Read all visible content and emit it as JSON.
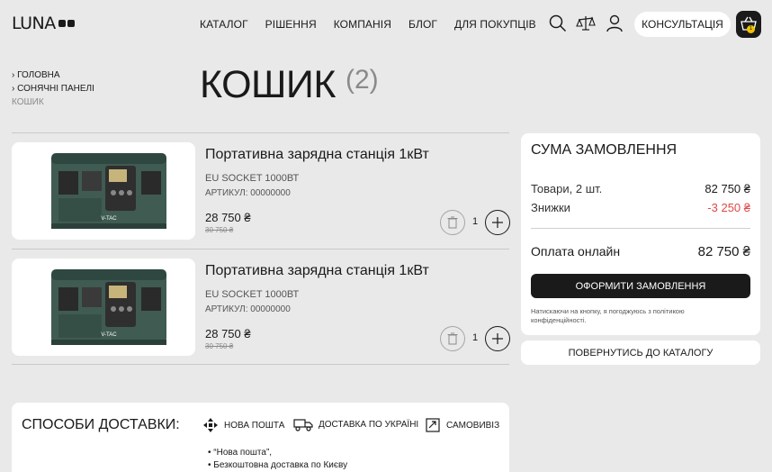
{
  "header": {
    "logo_text": "LUNA",
    "nav": [
      "КАТАЛОГ",
      "РІШЕННЯ",
      "КОМПАНІЯ",
      "БЛОГ",
      "ДЛЯ ПОКУПЦІВ"
    ],
    "consult_label": "КОНСУЛЬТАЦІЯ",
    "cart_count": "1",
    "icons": [
      "search-icon",
      "compare-scales-icon",
      "user-icon",
      "cart-basket-icon"
    ]
  },
  "breadcrumbs": {
    "items": [
      "ГОЛОВНА",
      "СОНЯЧНІ ПАНЕЛІ"
    ],
    "current": "КОШИК"
  },
  "page": {
    "title": "КОШИК",
    "count": "(2)"
  },
  "cart": {
    "items": [
      {
        "name": "Портативна зарядна станція 1кВт",
        "variant": "EU SOCKET 1000ВТ",
        "sku": "АРТИКУЛ: 00000000",
        "price": "28 750 ₴",
        "old_price": "30 750 ₴",
        "qty": "1",
        "image_label": "V-TAC"
      },
      {
        "name": "Портативна зарядна станція 1кВт",
        "variant": "EU SOCKET 1000ВТ",
        "sku": "АРТИКУЛ: 00000000",
        "price": "28 750 ₴",
        "old_price": "30 750 ₴",
        "qty": "1",
        "image_label": "V-TAC"
      }
    ]
  },
  "summary": {
    "title": "СУМА ЗАМОВЛЕННЯ",
    "goods_label": "Товари, 2 шт.",
    "goods_value": "82 750 ₴",
    "discount_label": "Знижки",
    "discount_value": "-3 250 ₴",
    "pay_label": "Оплата онлайн",
    "pay_value": "82 750 ₴",
    "order_button": "ОФОРМИТИ ЗАМОВЛЕННЯ",
    "note": "Натискаючи на кнопку, я погоджуюсь з політикою конфіденційності.",
    "back_button": "ПОВЕРНУТИСЬ ДО КАТАЛОГУ"
  },
  "delivery": {
    "title": "СПОСОБИ ДОСТАВКИ:",
    "options": [
      "НОВА ПОШТА",
      "ДОСТАВКА ПО УКРАЇНІ",
      "САМОВИВІЗ"
    ],
    "list": [
      "“Нова пошта”,",
      "Безкоштовна доставка по Києву"
    ]
  },
  "colors": {
    "background": "#e9e9e9",
    "accent_dark": "#1a1a1a",
    "discount": "#e0484a",
    "cart_badge": "#f2c200"
  }
}
